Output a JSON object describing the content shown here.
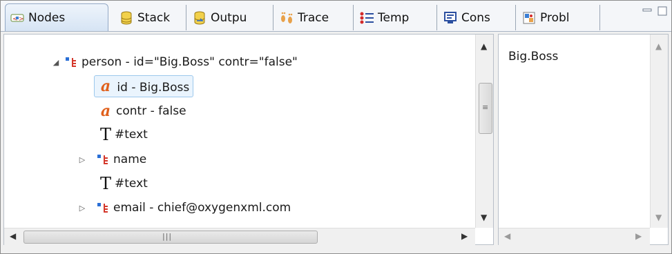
{
  "tabs": [
    {
      "label": "Nodes",
      "icon": "nodes-icon"
    },
    {
      "label": "Stack",
      "icon": "stack-icon"
    },
    {
      "label": "Outpu",
      "icon": "output-icon"
    },
    {
      "label": "Trace",
      "icon": "trace-icon"
    },
    {
      "label": "Temp",
      "icon": "templates-icon"
    },
    {
      "label": "Cons",
      "icon": "console-icon"
    },
    {
      "label": "Probl",
      "icon": "problems-icon"
    }
  ],
  "tree": {
    "rows": [
      {
        "text": "person - id=\"Big.Boss\" contr=\"false\"",
        "kind": "element",
        "twisty": "expanded"
      },
      {
        "text": "id - Big.Boss",
        "kind": "attribute",
        "twisty": "none",
        "selected": true
      },
      {
        "text": "contr - false",
        "kind": "attribute",
        "twisty": "none"
      },
      {
        "text": "#text",
        "kind": "text",
        "twisty": "none"
      },
      {
        "text": "name",
        "kind": "element",
        "twisty": "collapsed"
      },
      {
        "text": "#text",
        "kind": "text",
        "twisty": "none"
      },
      {
        "text": "email - chief@oxygenxml.com",
        "kind": "element",
        "twisty": "collapsed"
      }
    ]
  },
  "value_pane": {
    "text": "Big.Boss"
  },
  "colors": {
    "attribute_icon": "#e0601c",
    "element_blue": "#2a6fd6",
    "element_red": "#d4372b"
  }
}
